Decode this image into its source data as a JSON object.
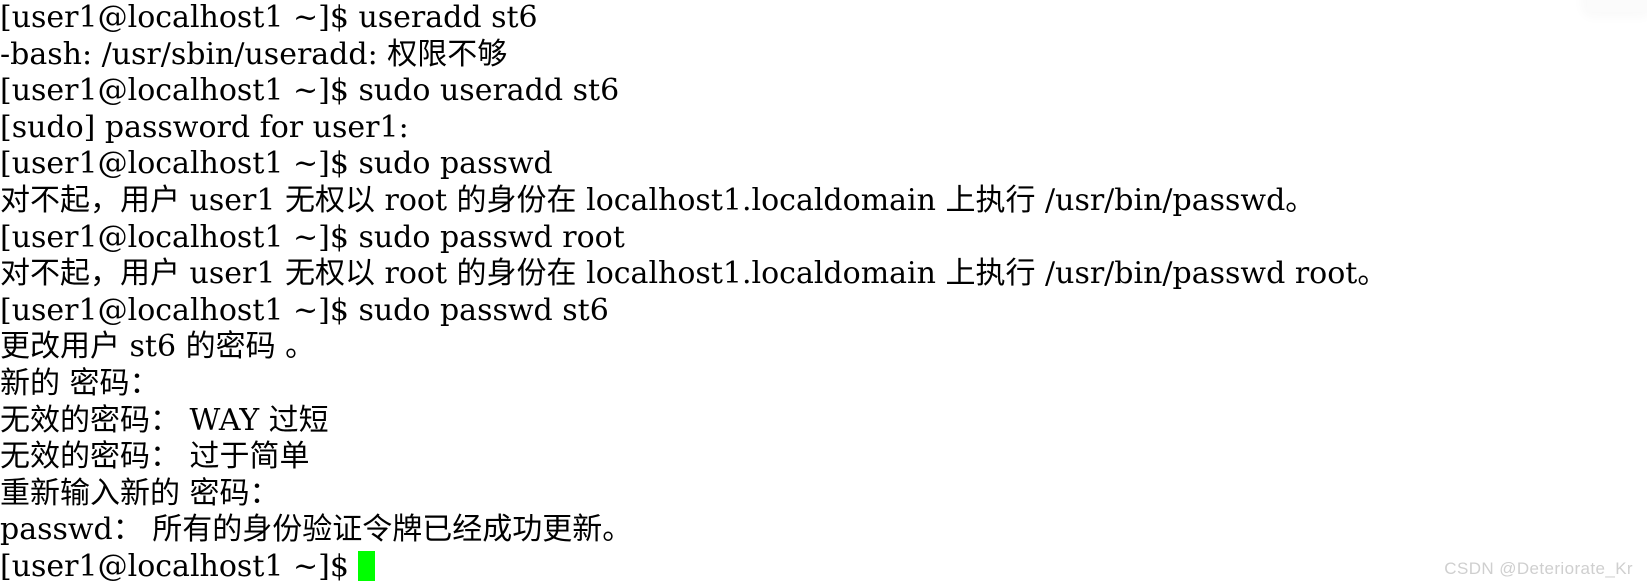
{
  "terminal": {
    "background_color": "#ffffff",
    "foreground_color": "#000000",
    "cursor_color": "#00ff00",
    "prompt": "[user1@localhost1 ~]$ ",
    "lines": [
      {
        "id": "l1",
        "type": "command",
        "text": "[user1@localhost1 ~]$ useradd st6"
      },
      {
        "id": "l2",
        "type": "output",
        "text": "-bash: /usr/sbin/useradd: 权限不够"
      },
      {
        "id": "l3",
        "type": "command",
        "text": "[user1@localhost1 ~]$ sudo useradd st6"
      },
      {
        "id": "l4",
        "type": "output",
        "text": "[sudo] password for user1:"
      },
      {
        "id": "l5",
        "type": "command",
        "text": "[user1@localhost1 ~]$ sudo passwd"
      },
      {
        "id": "l6",
        "type": "output",
        "text": "对不起，用户 user1 无权以 root 的身份在 localhost1.localdomain 上执行 /usr/bin/passwd。"
      },
      {
        "id": "l7",
        "type": "command",
        "text": "[user1@localhost1 ~]$ sudo passwd root"
      },
      {
        "id": "l8",
        "type": "output",
        "text": "对不起，用户 user1 无权以 root 的身份在 localhost1.localdomain 上执行 /usr/bin/passwd root。"
      },
      {
        "id": "l9",
        "type": "command",
        "text": "[user1@localhost1 ~]$ sudo passwd st6"
      },
      {
        "id": "l10",
        "type": "output",
        "text": "更改用户 st6 的密码 。"
      },
      {
        "id": "l11",
        "type": "output",
        "text": "新的 密码："
      },
      {
        "id": "l12",
        "type": "output",
        "text": "无效的密码： WAY 过短"
      },
      {
        "id": "l13",
        "type": "output",
        "text": "无效的密码： 过于简单"
      },
      {
        "id": "l14",
        "type": "output",
        "text": "重新输入新的 密码："
      },
      {
        "id": "l15",
        "type": "output",
        "text": "passwd： 所有的身份验证令牌已经成功更新。"
      }
    ],
    "last_line": {
      "prompt_text": "[user1@localhost1 ~]$ ",
      "input_text": ""
    }
  },
  "watermark": {
    "text": "CSDN @Deteriorate_Kr",
    "color": "#cfcfcf"
  }
}
